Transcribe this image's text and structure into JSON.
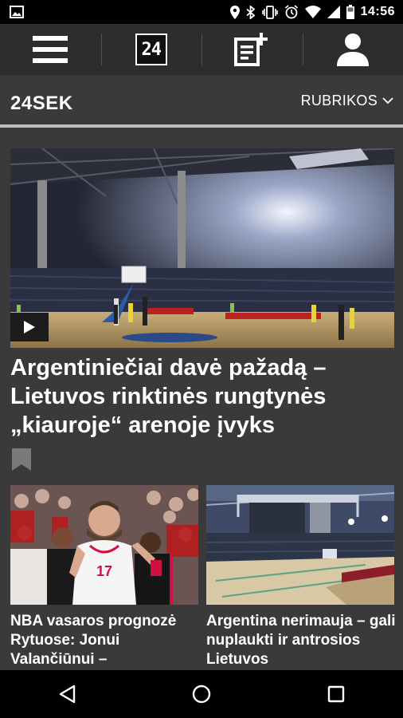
{
  "status_bar": {
    "time": "14:56"
  },
  "top_nav": {
    "items": [
      {
        "icon": "menu-icon"
      },
      {
        "icon": "24-icon",
        "label": "24"
      },
      {
        "icon": "add-post-icon"
      },
      {
        "icon": "user-icon"
      }
    ]
  },
  "section": {
    "brand": "24SEK",
    "menu_label": "RUBRIKOS"
  },
  "main_article": {
    "title": "Argentiniečiai davė pažadą – Lietuvos rinktinės rungtynės „kiauroje“ arenoje įvyks",
    "has_video": true
  },
  "articles": [
    {
      "title": "NBA vasaros prognozė Rytuose: Jonui Valančiūnui –",
      "jersey_number": "17"
    },
    {
      "title": "Argentina nerimauja – gali nuplaukti ir antrosios Lietuvos"
    }
  ],
  "colors": {
    "background": "#3a3a3a",
    "topbar": "#2d2d2d",
    "divider": "#bdbdbd",
    "accent_red": "#ce1141"
  }
}
